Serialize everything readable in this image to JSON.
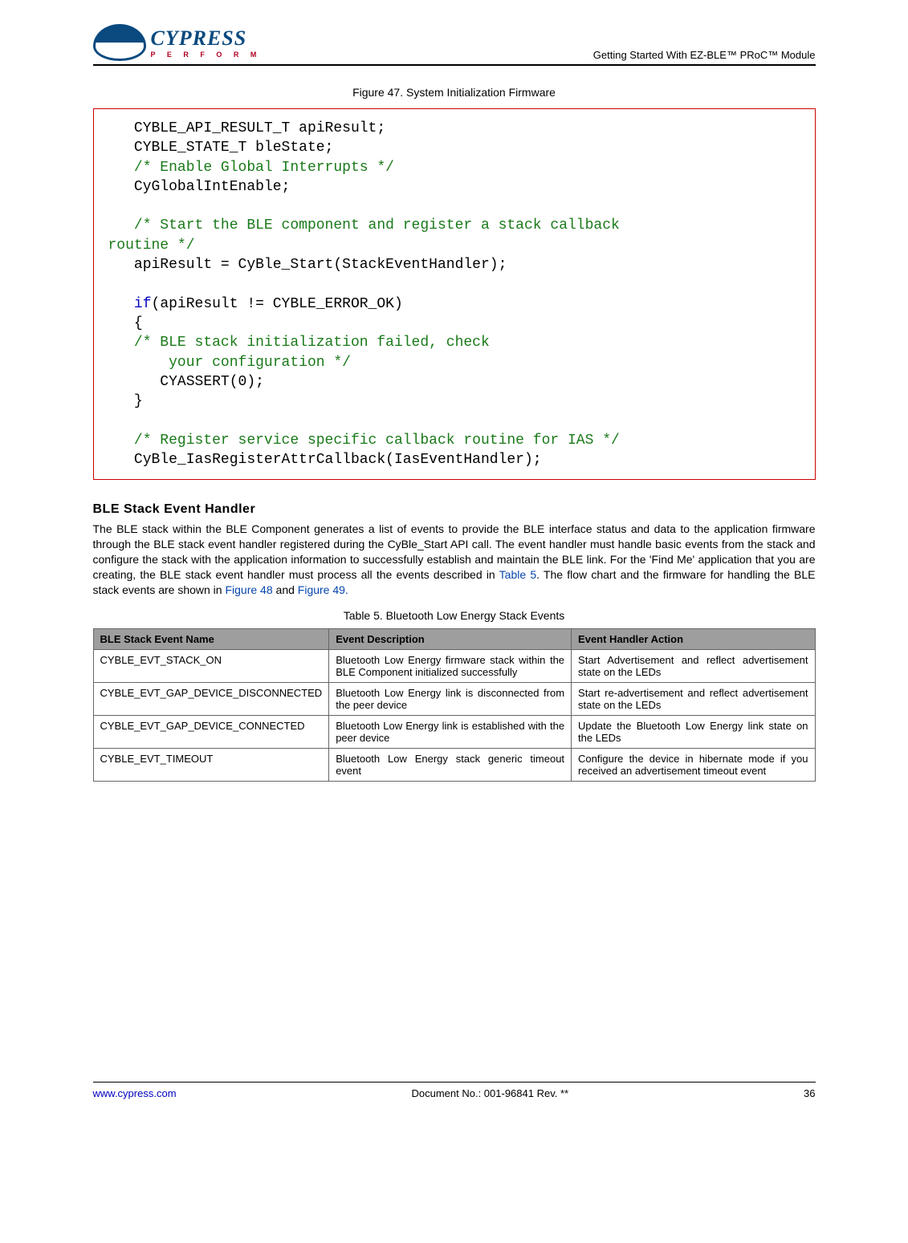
{
  "header": {
    "brand": "CYPRESS",
    "tagline": "P E R F O R M",
    "doc_title": "Getting Started With EZ-BLE™ PRoC™ Module"
  },
  "figure_caption": "Figure 47. System Initialization Firmware",
  "code": {
    "l1": "   CYBLE_API_RESULT_T apiResult;",
    "l2": "   CYBLE_STATE_T bleState;",
    "l3": "   /* Enable Global Interrupts */",
    "l4": "   CyGlobalIntEnable;",
    "l5": "",
    "l6a": "   /* Start the BLE component and register a stack callback",
    "l6b": "routine */",
    "l7": "   apiResult = CyBle_Start(StackEventHandler);",
    "l8": "",
    "l9a": "   if",
    "l9b": "(apiResult != CYBLE_ERROR_OK)",
    "l10": "   {",
    "l11a": "   /* BLE stack initialization failed, check",
    "l11b": "       your configuration */",
    "l12": "      CYASSERT(0);",
    "l13": "   }",
    "l14": "",
    "l15": "   /* Register service specific callback routine for IAS */",
    "l16": "   CyBle_IasRegisterAttrCallback(IasEventHandler);"
  },
  "section_heading": "BLE Stack Event Handler",
  "body_text_pre": "The BLE stack within the BLE Component generates a list of events to provide the BLE interface status and data to the application firmware through the BLE stack event handler registered during the CyBle_Start API call. The event handler must handle basic events from the stack and configure the stack with the application information to successfully establish and maintain the BLE link. For the 'Find Me' application that you are creating, the BLE stack event handler must process all the events described in ",
  "body_link1": "Table 5",
  "body_text_mid": ". The flow chart and the firmware for handling the BLE stack events are shown in ",
  "body_link2": "Figure 48",
  "body_text_and": " and ",
  "body_link3": "Figure 49.",
  "table_caption": "Table 5. Bluetooth Low Energy Stack Events",
  "table": {
    "h1": "BLE Stack Event Name",
    "h2": "Event Description",
    "h3": "Event Handler Action",
    "rows": [
      {
        "c1": "CYBLE_EVT_STACK_ON",
        "c2": "Bluetooth Low Energy firmware stack within the BLE Component initialized successfully",
        "c3": "Start Advertisement and reflect advertisement state on the LEDs"
      },
      {
        "c1": "CYBLE_EVT_GAP_DEVICE_DISCONNECTED",
        "c2": "Bluetooth Low Energy link is disconnected from  the peer device",
        "c3": "Start re-advertisement and reflect advertisement state on the LEDs"
      },
      {
        "c1": "CYBLE_EVT_GAP_DEVICE_CONNECTED",
        "c2": "Bluetooth Low Energy link is established with the peer device",
        "c3": "Update the Bluetooth Low Energy link state on the LEDs"
      },
      {
        "c1": "CYBLE_EVT_TIMEOUT",
        "c2": "Bluetooth Low Energy stack generic timeout event",
        "c3": "Configure the device in hibernate mode if you received an advertisement timeout event"
      }
    ]
  },
  "footer": {
    "url": "www.cypress.com",
    "docno": "Document No.: 001-96841 Rev. **",
    "page": "36"
  }
}
